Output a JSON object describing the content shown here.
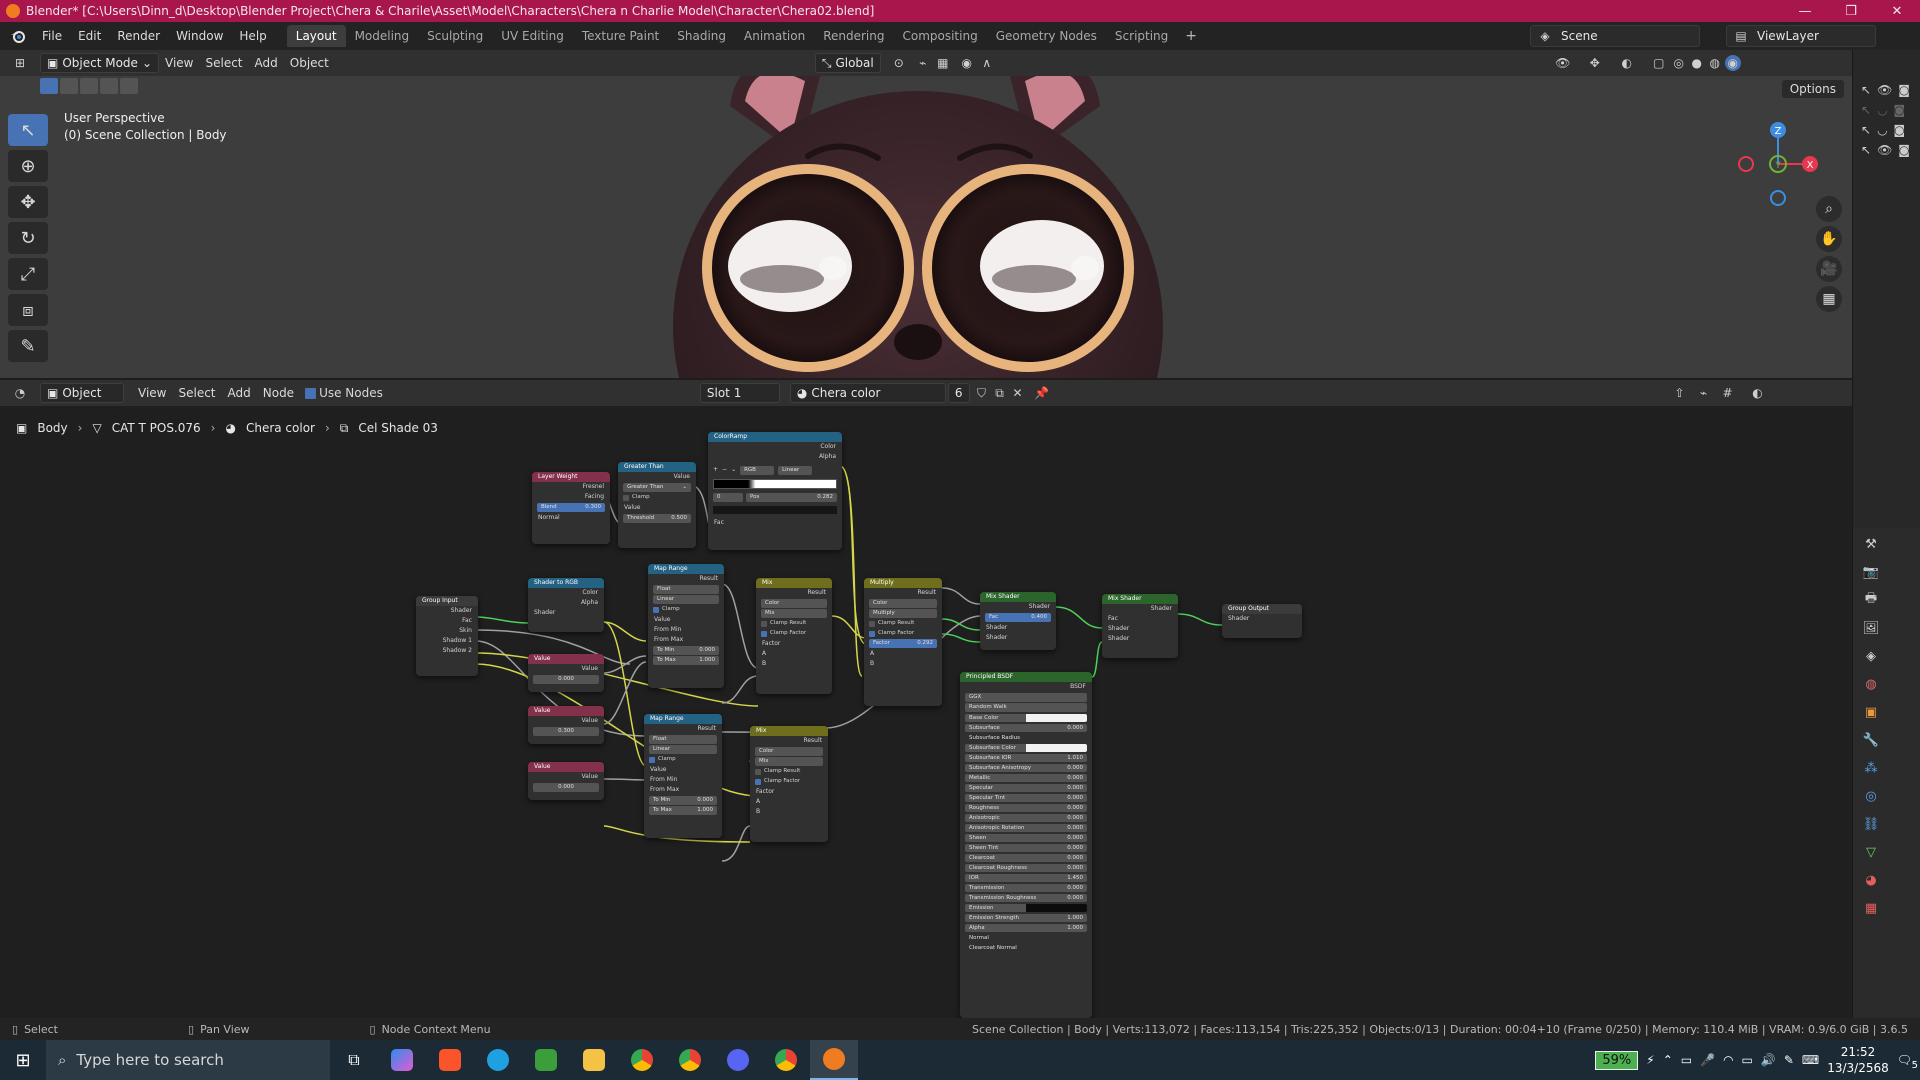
{
  "titlebar": {
    "title": "Blender* [C:\\Users\\Dinn_d\\Desktop\\Blender Project\\Chera & Charile\\Asset\\Model\\Characters\\Chera n Charlie Model\\Character\\Chera02.blend]",
    "minimize": "—",
    "maximize": "❐",
    "close": "✕"
  },
  "menubar": {
    "items": [
      "File",
      "Edit",
      "Render",
      "Window",
      "Help"
    ],
    "workspaces": [
      "Layout",
      "Modeling",
      "Sculpting",
      "UV Editing",
      "Texture Paint",
      "Shading",
      "Animation",
      "Rendering",
      "Compositing",
      "Geometry Nodes",
      "Scripting"
    ],
    "active_workspace": "Layout",
    "add_label": "+",
    "scene": "Scene",
    "view_layer": "ViewLayer"
  },
  "viewport_header": {
    "mode": "Object Mode",
    "menus": [
      "View",
      "Select",
      "Add",
      "Object"
    ],
    "orientation": "Global",
    "options": "Options"
  },
  "viewport": {
    "view_name": "User Perspective",
    "collection_info": "(0) Scene Collection | Body",
    "gizmo": {
      "x": "X",
      "y": "Y",
      "z": "Z",
      "x_color": "#e8384f",
      "y_color": "#6eb533",
      "z_color": "#3d8ee0"
    }
  },
  "node_header": {
    "type": "Object",
    "menus": [
      "View",
      "Select",
      "Add",
      "Node"
    ],
    "use_nodes": "Use Nodes",
    "slot": "Slot 1",
    "material": "Chera color",
    "users": "6"
  },
  "breadcrumb": {
    "object": "Body",
    "mesh": "CAT T POS.076",
    "material": "Chera color",
    "group": "Cel Shade 03"
  },
  "nodes": {
    "layer_weight": {
      "title": "Layer Weight",
      "out1": "Fresnel",
      "out2": "Facing",
      "blend": "Blend",
      "blend_val": "0.300",
      "normal": "Normal"
    },
    "greater_than": {
      "title": "Greater Than",
      "value": "Value",
      "op": "Greater Than",
      "clamp": "Clamp",
      "value_in": "Value",
      "threshold": "Threshold",
      "threshold_val": "0.500"
    },
    "color_ramp": {
      "title": "ColorRamp",
      "color": "Color",
      "alpha": "Alpha",
      "mode": "RGB",
      "interp": "Linear",
      "pos_idx": "0",
      "pos": "Pos",
      "pos_val": "0.282",
      "fac": "Fac"
    },
    "group_input": {
      "title": "Group Input",
      "outs": [
        "Shader",
        "Fac",
        "Skin",
        "Shadow 1",
        "Shadow 2"
      ]
    },
    "shader_to_rgb": {
      "title": "Shader to RGB",
      "color": "Color",
      "alpha": "Alpha",
      "shader": "Shader"
    },
    "value1": {
      "title": "Value",
      "out": "Value",
      "val": "0.000"
    },
    "value2": {
      "title": "Value",
      "out": "Value",
      "val": "0.300"
    },
    "value3": {
      "title": "Value",
      "out": "Value",
      "val": "0.000"
    },
    "map_range1": {
      "title": "Map Range",
      "result": "Result",
      "dtype": "Float",
      "interp": "Linear",
      "clamp": "Clamp",
      "value": "Value",
      "from_min": "From Min",
      "from_max": "From Max",
      "to_min": "To Min",
      "to_min_val": "0.000",
      "to_max": "To Max",
      "to_max_val": "1.000"
    },
    "map_range2": {
      "title": "Map Range",
      "result": "Result",
      "dtype": "Float",
      "interp": "Linear",
      "clamp": "Clamp",
      "value": "Value",
      "from_min": "From Min",
      "from_max": "From Max",
      "to_min": "To Min",
      "to_min_val": "0.000",
      "to_max": "To Max",
      "to_max_val": "1.000"
    },
    "mix1": {
      "title": "Mix",
      "result": "Result",
      "dtype": "Color",
      "blend": "Mix",
      "clamp_result": "Clamp Result",
      "clamp_factor": "Clamp Factor",
      "factor": "Factor",
      "a": "A",
      "b": "B"
    },
    "mix2": {
      "title": "Mix",
      "result": "Result",
      "dtype": "Color",
      "blend": "Mix",
      "clamp_result": "Clamp Result",
      "clamp_factor": "Clamp Factor",
      "factor": "Factor",
      "a": "A",
      "b": "B"
    },
    "multiply": {
      "title": "Multiply",
      "result": "Result",
      "dtype": "Color",
      "blend": "Multiply",
      "clamp_result": "Clamp Result",
      "clamp_factor": "Clamp Factor",
      "factor": "Factor",
      "factor_val": "0.292",
      "a": "A",
      "b": "B"
    },
    "mix_shader1": {
      "title": "Mix Shader",
      "shader_out": "Shader",
      "fac": "Fac",
      "fac_val": "0.400",
      "s1": "Shader",
      "s2": "Shader"
    },
    "mix_shader2": {
      "title": "Mix Shader",
      "shader_out": "Shader",
      "fac": "Fac",
      "s1": "Shader",
      "s2": "Shader"
    },
    "group_output": {
      "title": "Group Output",
      "shader": "Shader"
    },
    "principled": {
      "title": "Principled BSDF",
      "bsdf": "BSDF",
      "dist": "GGX",
      "sss": "Random Walk",
      "rows": [
        {
          "label": "Base Color",
          "val": ""
        },
        {
          "label": "Subsurface",
          "val": "0.000"
        },
        {
          "label": "Subsurface Radius",
          "val": ""
        },
        {
          "label": "Subsurface Color",
          "val": ""
        },
        {
          "label": "Subsurface IOR",
          "val": "1.010"
        },
        {
          "label": "Subsurface Anisotropy",
          "val": "0.000"
        },
        {
          "label": "Metallic",
          "val": "0.000"
        },
        {
          "label": "Specular",
          "val": "0.000"
        },
        {
          "label": "Specular Tint",
          "val": "0.000"
        },
        {
          "label": "Roughness",
          "val": "0.000"
        },
        {
          "label": "Anisotropic",
          "val": "0.000"
        },
        {
          "label": "Anisotropic Rotation",
          "val": "0.000"
        },
        {
          "label": "Sheen",
          "val": "0.000"
        },
        {
          "label": "Sheen Tint",
          "val": "0.000"
        },
        {
          "label": "Clearcoat",
          "val": "0.000"
        },
        {
          "label": "Clearcoat Roughness",
          "val": "0.000"
        },
        {
          "label": "IOR",
          "val": "1.450"
        },
        {
          "label": "Transmission",
          "val": "0.000"
        },
        {
          "label": "Transmission Roughness",
          "val": "0.000"
        },
        {
          "label": "Emission",
          "val": ""
        },
        {
          "label": "Emission Strength",
          "val": "1.000"
        },
        {
          "label": "Alpha",
          "val": "1.000"
        },
        {
          "label": "Normal",
          "val": ""
        },
        {
          "label": "Clearcoat Normal",
          "val": ""
        }
      ]
    }
  },
  "statusbar": {
    "select": "Select",
    "pan": "Pan View",
    "context": "Node Context Menu",
    "stats": "Scene Collection | Body | Verts:113,072 | Faces:113,154 | Tris:225,352 | Objects:0/13 | Duration: 00:04+10 (Frame 0/250) | Memory: 110.4 MiB | VRAM: 0.9/6.0 GiB | 3.6.5"
  },
  "taskbar": {
    "search_placeholder": "Type here to search",
    "battery": "59%",
    "time": "21:52",
    "date": "13/3/2568",
    "notif_count": "5"
  }
}
